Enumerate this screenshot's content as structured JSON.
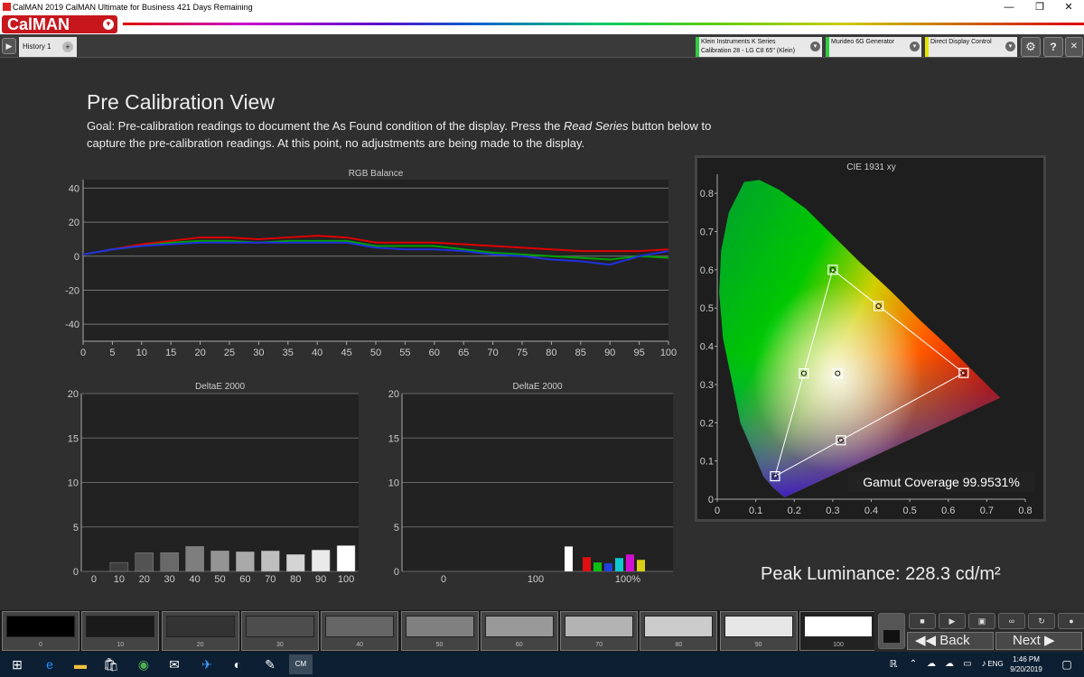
{
  "window": {
    "title": "CalMAN 2019 CalMAN Ultimate for Business 421 Days Remaining",
    "minimize": "—",
    "restore": "❐",
    "close": "✕"
  },
  "brand": {
    "logo": "CalMAN",
    "menu_icon": "chevron-down-icon"
  },
  "toolbar": {
    "play_icon": "play-icon",
    "tab_label": "History 1",
    "add_tab": "+",
    "devices": [
      {
        "line1": "Klein Instruments K Series",
        "line2": "Calibration 28 - LG C8 65\" (Klein)",
        "color": "#2ecc40"
      },
      {
        "line1": "Murideo 6G Generator",
        "line2": "",
        "color": "#2ecc40"
      },
      {
        "line1": "Direct Display Control",
        "line2": "",
        "color": "#e5e500"
      }
    ],
    "settings_icon": "gear-icon",
    "help_label": "?",
    "close_label": "✕"
  },
  "page": {
    "title": "Pre Calibration View",
    "goal_a": "Goal: Pre-calibration readings to document the As Found condition of the display. Press the ",
    "goal_em": "Read Series",
    "goal_b": " button below to capture the pre-calibration readings. At this point, no adjustments are being made to the display."
  },
  "chart_data": [
    {
      "type": "line",
      "title": "RGB Balance",
      "x": [
        0,
        5,
        10,
        15,
        20,
        25,
        30,
        35,
        40,
        45,
        50,
        55,
        60,
        65,
        70,
        75,
        80,
        85,
        90,
        95,
        100
      ],
      "xticks": [
        "0",
        "5",
        "10",
        "15",
        "20",
        "25",
        "30",
        "35",
        "40",
        "45",
        "50",
        "55",
        "60",
        "65",
        "70",
        "75",
        "80",
        "85",
        "90",
        "95",
        "100"
      ],
      "yticks": [
        "40",
        "20",
        "0",
        "-20",
        "-40"
      ],
      "ylim": [
        -50,
        45
      ],
      "series": [
        {
          "color": "#e00000",
          "values": [
            1,
            4,
            7,
            9,
            11,
            11,
            10,
            11,
            12,
            11,
            8,
            8,
            8,
            7,
            6,
            5,
            4,
            3,
            3,
            3,
            4
          ]
        },
        {
          "color": "#00a000",
          "values": [
            1,
            4,
            6,
            8,
            9,
            9,
            8,
            9,
            9,
            9,
            6,
            6,
            6,
            4,
            2,
            1,
            0,
            -1,
            -2,
            0,
            -1
          ]
        },
        {
          "color": "#2030e0",
          "values": [
            1,
            4,
            6,
            7,
            8,
            8,
            8,
            8,
            8,
            8,
            5,
            4,
            4,
            3,
            1,
            0,
            -2,
            -3,
            -5,
            0,
            3
          ]
        }
      ]
    },
    {
      "type": "bar",
      "title": "DeltaE 2000",
      "categories": [
        "0",
        "10",
        "20",
        "30",
        "40",
        "50",
        "60",
        "70",
        "80",
        "90",
        "100"
      ],
      "values": [
        0,
        1.0,
        2.1,
        2.1,
        2.8,
        2.3,
        2.2,
        2.3,
        1.9,
        2.4,
        2.9
      ],
      "yticks": [
        "20",
        "15",
        "10",
        "5",
        "0"
      ],
      "ylim": [
        0,
        20
      ]
    },
    {
      "type": "bar",
      "title": "DeltaE 2000",
      "xticks": [
        "0",
        "100",
        "100%"
      ],
      "bars": [
        {
          "color": "#ffffff",
          "value": 2.8
        },
        {
          "color": "#e01010",
          "value": 1.6
        },
        {
          "color": "#10c010",
          "value": 1.0
        },
        {
          "color": "#2040e0",
          "value": 0.9
        },
        {
          "color": "#10c8d0",
          "value": 1.5
        },
        {
          "color": "#d010d0",
          "value": 1.9
        },
        {
          "color": "#d8d010",
          "value": 1.3
        }
      ],
      "yticks": [
        "20",
        "15",
        "10",
        "5",
        "0"
      ],
      "ylim": [
        0,
        20
      ]
    },
    {
      "type": "scatter",
      "title": "CIE 1931 xy",
      "xticks": [
        "0",
        "0.1",
        "0.2",
        "0.3",
        "0.4",
        "0.5",
        "0.6",
        "0.7",
        "0.8"
      ],
      "yticks": [
        "0.8",
        "0.7",
        "0.6",
        "0.5",
        "0.4",
        "0.3",
        "0.2",
        "0.1",
        "0"
      ],
      "xlim": [
        0,
        0.8
      ],
      "ylim": [
        0,
        0.85
      ],
      "targets": [
        {
          "name": "red",
          "x": 0.64,
          "y": 0.33
        },
        {
          "name": "green",
          "x": 0.3,
          "y": 0.6
        },
        {
          "name": "blue",
          "x": 0.15,
          "y": 0.06
        },
        {
          "name": "white",
          "x": 0.3127,
          "y": 0.329
        },
        {
          "name": "cyan",
          "x": 0.225,
          "y": 0.329
        },
        {
          "name": "magenta",
          "x": 0.321,
          "y": 0.154
        },
        {
          "name": "yellow",
          "x": 0.419,
          "y": 0.505
        }
      ]
    }
  ],
  "gamut": "Gamut Coverage 99.9531%",
  "peak": "Peak Luminance: 228.3 cd/m²",
  "swatches": [
    {
      "label": "0",
      "color": "#000000"
    },
    {
      "label": "10",
      "color": "#1a1a1a"
    },
    {
      "label": "20",
      "color": "#333333"
    },
    {
      "label": "30",
      "color": "#4d4d4d"
    },
    {
      "label": "40",
      "color": "#666666"
    },
    {
      "label": "50",
      "color": "#808080"
    },
    {
      "label": "60",
      "color": "#999999"
    },
    {
      "label": "70",
      "color": "#b3b3b3"
    },
    {
      "label": "80",
      "color": "#cccccc"
    },
    {
      "label": "90",
      "color": "#e6e6e6"
    },
    {
      "label": "100",
      "color": "#ffffff"
    }
  ],
  "controls": {
    "back": "Back",
    "next": "Next"
  },
  "taskbar": {
    "lang": "ENG",
    "time": "1:46 PM",
    "date": "9/20/2019"
  }
}
